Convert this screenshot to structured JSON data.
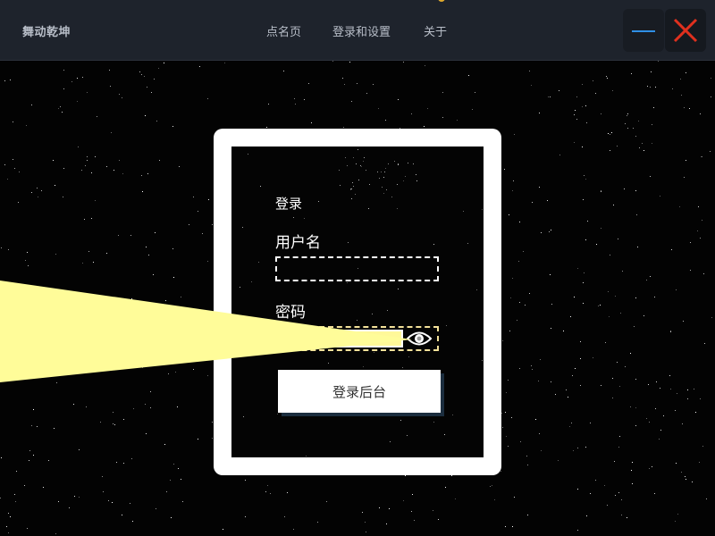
{
  "app": {
    "brand": "舞动乾坤"
  },
  "nav": {
    "items": [
      {
        "label": "点名页"
      },
      {
        "label": "登录和设置"
      },
      {
        "label": "关于"
      }
    ]
  },
  "window_controls": {
    "minimize_icon": "minus-icon",
    "close_icon": "close-x-icon",
    "minimize_color": "#2f8fe6",
    "close_color": "#e0301e"
  },
  "login": {
    "title": "登录",
    "username_label": "用户名",
    "username_value": "",
    "password_label": "密码",
    "password_value": "",
    "toggle_icon": "eye-icon",
    "submit_label": "登录后台"
  },
  "theme": {
    "topbar_bg": "#1e232c",
    "beam_color": "#fffc99",
    "card_bg": "#ffffff",
    "accent": "#e0a92c"
  }
}
